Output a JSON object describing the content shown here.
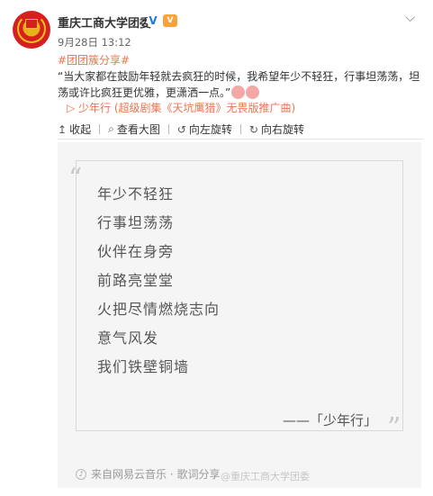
{
  "account": {
    "name": "重庆工商大学团委",
    "verified_mark": "V",
    "vip_badge": "V",
    "time": "9月28日 13:12"
  },
  "post": {
    "tag": "#团团簇分享#",
    "body": "“当大家都在鼓励年轻就去疯狂的时候，我希望年少不轻狂，行事坦荡荡，坦荡或许比疯狂更优雅，更潇洒一点。”",
    "music_link": "▷ 少年行 (超级剧集《天坑鹰猎》无畏版推广曲)"
  },
  "toolbar": {
    "collapse": "收起",
    "view_large": "查看大图",
    "rotate_left": "向左旋转",
    "rotate_right": "向右旋转"
  },
  "card": {
    "lines": [
      "年少不轻狂",
      "行事坦荡荡",
      "伙伴在身旁",
      "前路亮堂堂",
      "火把尽情燃烧志向",
      "意气风发",
      "我们铁壁铜墙"
    ],
    "signature": "——「少年行」",
    "source": "来自网易云音乐 · 歌词分享"
  },
  "watermark": "@重庆工商大学团委",
  "icons": {
    "chevron": "chevron-down-icon",
    "collapse": "collapse-icon",
    "zoom": "magnifier-icon",
    "rotate_left": "rotate-left-icon",
    "rotate_right": "rotate-right-icon"
  },
  "colors": {
    "link": "#eb7350",
    "verify": "#1e7ad3",
    "vip": "#f7a23b"
  }
}
